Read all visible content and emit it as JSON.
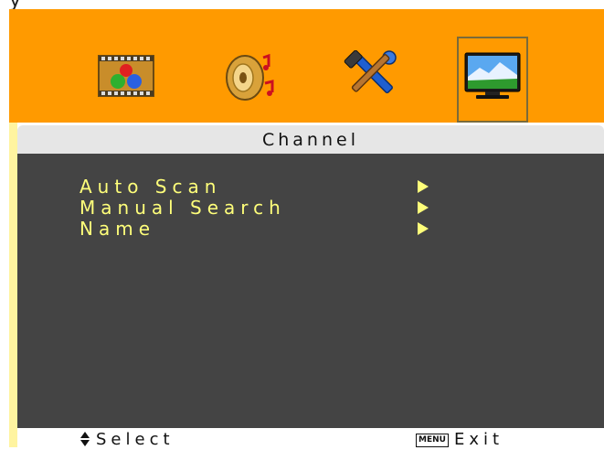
{
  "header": {
    "top_fragment": "y",
    "icons": [
      {
        "name": "picture-icon",
        "selected": false
      },
      {
        "name": "sound-icon",
        "selected": false
      },
      {
        "name": "setup-tools-icon",
        "selected": false
      },
      {
        "name": "channel-tv-icon",
        "selected": true
      }
    ]
  },
  "title": "Channel",
  "menu": {
    "items": [
      {
        "label": "Auto Scan"
      },
      {
        "label": "Manual Search"
      },
      {
        "label": "Name"
      }
    ]
  },
  "footer": {
    "select_label": "Select",
    "menu_key": "MENU",
    "exit_label": "Exit"
  },
  "colors": {
    "orange_bar": "#ff9a00",
    "menu_text": "#ffff7a",
    "content_bg": "#444444",
    "title_bg": "#e6e6e6"
  }
}
